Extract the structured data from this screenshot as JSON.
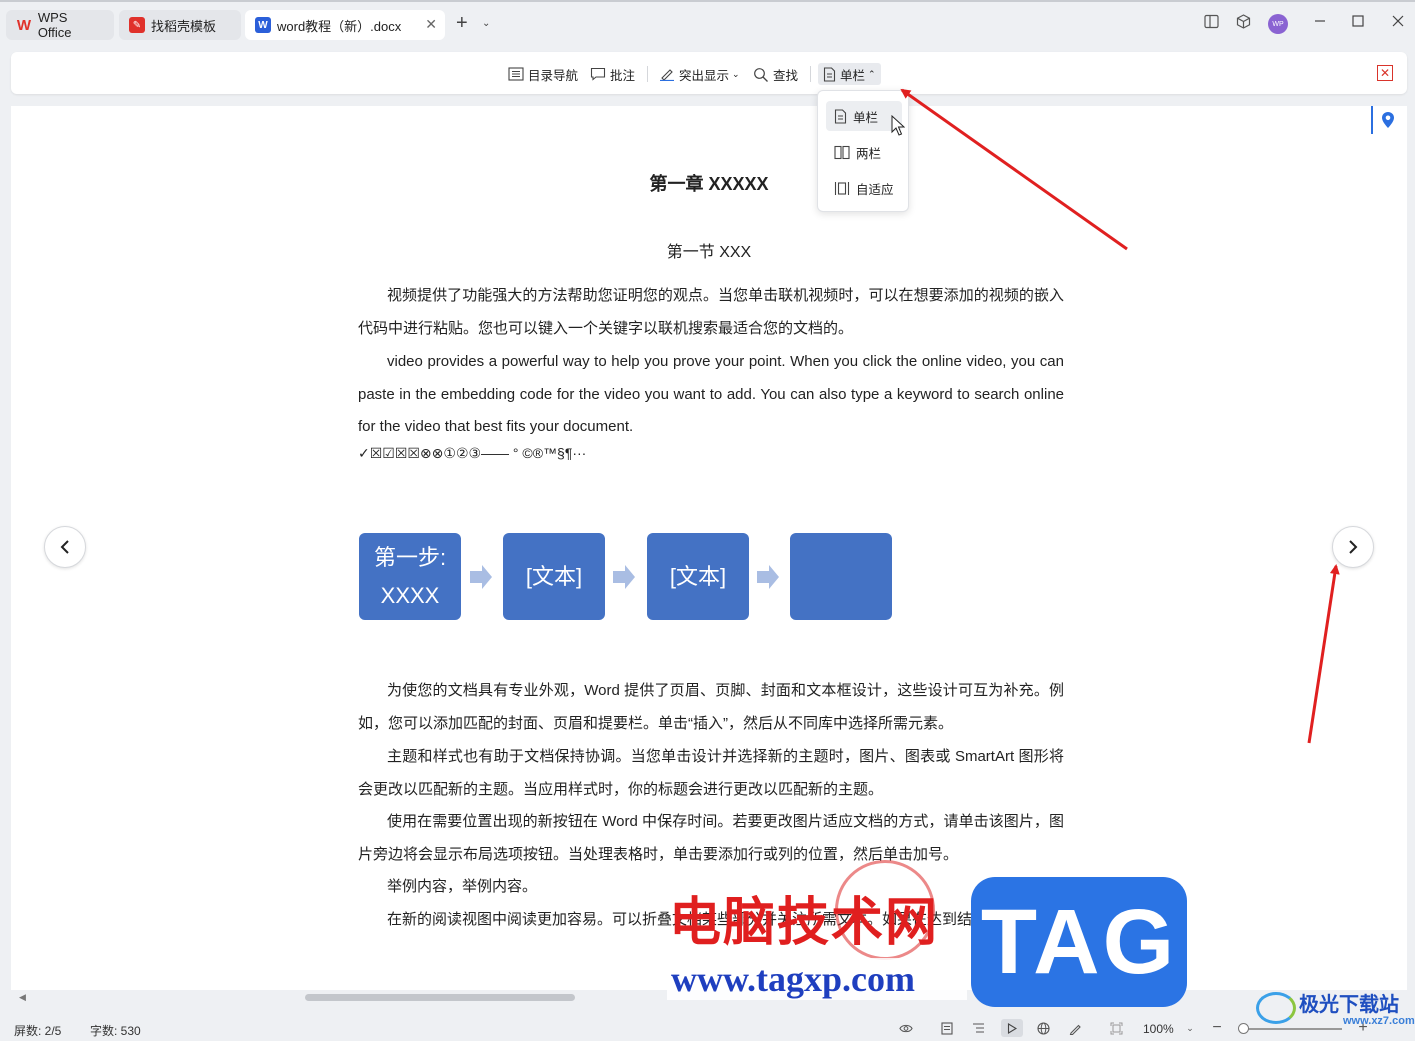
{
  "tabs": [
    {
      "label": "WPS Office"
    },
    {
      "label": "找稻壳模板"
    },
    {
      "label": "word教程（新）.docx"
    }
  ],
  "avatar_text": "WP",
  "toolbar": {
    "toc_label": "目录导航",
    "comment_label": "批注",
    "highlight_label": "突出显示",
    "find_label": "查找",
    "layout_label": "单栏"
  },
  "layout_menu": {
    "items": [
      {
        "label": "单栏",
        "selected": true
      },
      {
        "label": "两栏",
        "selected": false
      },
      {
        "label": "自适应",
        "selected": false
      }
    ]
  },
  "document": {
    "chapter_title": "第一章  XXXXX",
    "section_title": "第一节  XXX",
    "p1": "视频提供了功能强大的方法帮助您证明您的观点。当您单击联机视频时，可以在想要添加的视频的嵌入代码中进行粘贴。您也可以键入一个关键字以联机搜索最适合您的文档的。",
    "p2": "video provides a powerful way to help you prove your point. When you click the online video, you can paste in the embedding code for the video you want to add. You can also type a keyword to search online for the video that best fits your document.",
    "symbols": "✓☒☑☒☒⊗⊗①②③——   °  ©®™§¶···",
    "smartart": {
      "step1_line1": "第一步:",
      "step1_line2": "XXXX",
      "step2": "[文本]",
      "step3": "[文本]",
      "step4": ""
    },
    "p3": "为使您的文档具有专业外观，Word 提供了页眉、页脚、封面和文本框设计，这些设计可互为补充。例如，您可以添加匹配的封面、页眉和提要栏。单击“插入”，然后从不同库中选择所需元素。",
    "p4": "主题和样式也有助于文档保持协调。当您单击设计并选择新的主题时，图片、图表或 SmartArt 图形将会更改以匹配新的主题。当应用样式时，你的标题会进行更改以匹配新的主题。",
    "p5": "使用在需要位置出现的新按钮在 Word 中保存时间。若要更改图片适应文档的方式，请单击该图片，图片旁边将会显示布局选项按钮。当处理表格时，单击要添加行或列的位置，然后单击加号。",
    "p6": "举例内容，举例内容。",
    "p7": "在新的阅读视图中阅读更加容易。可以折叠文档某些部分并关注所需文本。如果在达到结尾"
  },
  "status": {
    "page": "屏数: 2/5",
    "words": "字数: 530",
    "zoom": "100%"
  },
  "watermark": {
    "cn": "电脑技术网",
    "url": "www.tagxp.com",
    "tag": "TAG",
    "logo": "极光下载站",
    "logo_url": "www.xz7.com"
  },
  "colors": {
    "smartart": "#4472c4",
    "annotation_arrow": "#e02020",
    "accent": "#2b6fe0"
  }
}
